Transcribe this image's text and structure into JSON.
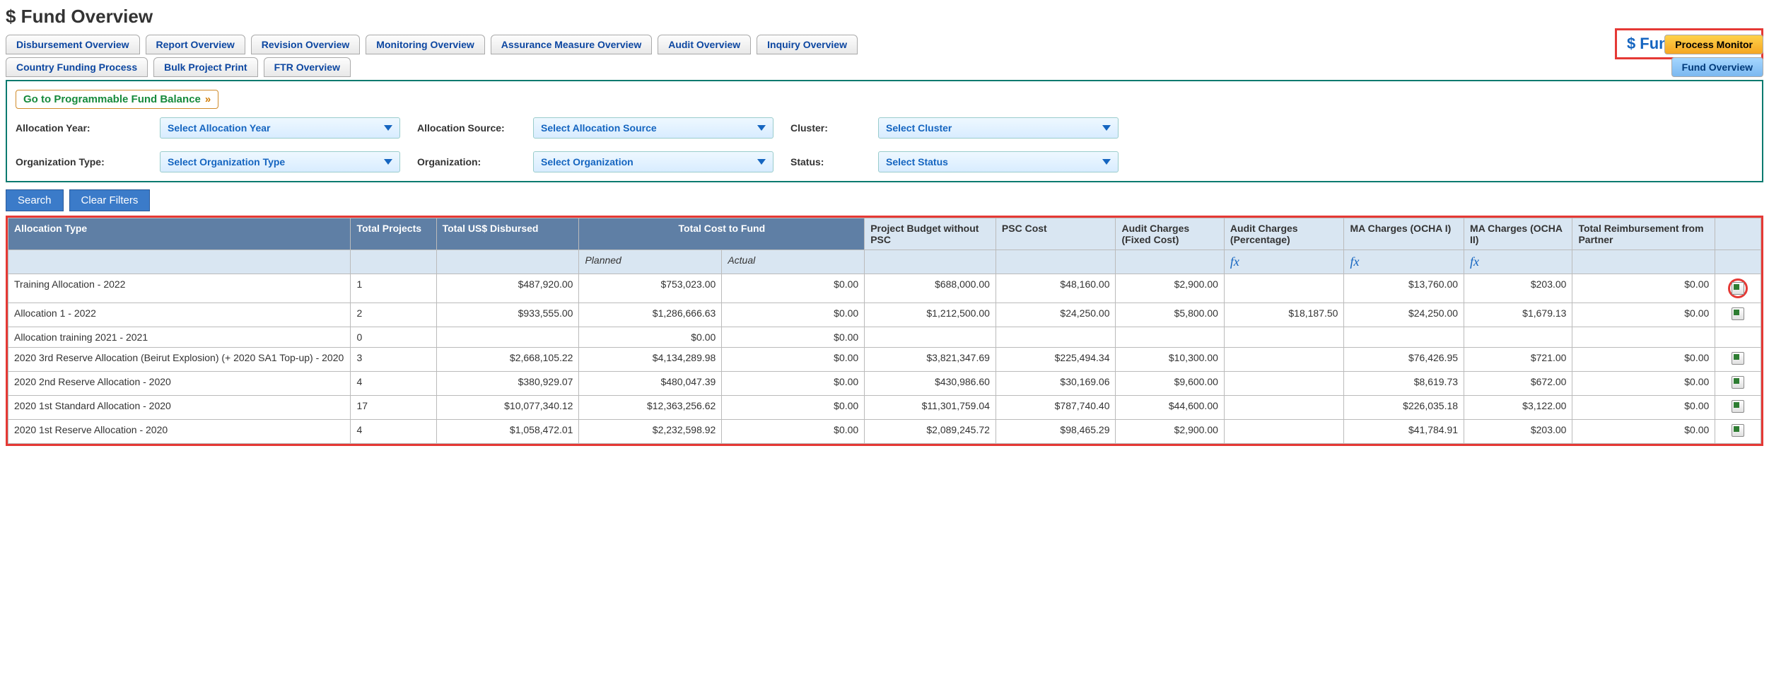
{
  "page_title": "$ Fund Overview",
  "side_title": "$ Fund Overview",
  "tabs_row1": [
    "Disbursement Overview",
    "Report Overview",
    "Revision Overview",
    "Monitoring Overview",
    "Assurance Measure Overview",
    "Audit Overview",
    "Inquiry Overview"
  ],
  "tabs_row2": [
    "Country Funding Process",
    "Bulk Project Print",
    "FTR Overview"
  ],
  "pills": {
    "process_monitor": "Process Monitor",
    "fund_overview": "Fund Overview"
  },
  "go_link": "Go to Programmable Fund Balance",
  "filters": {
    "allocation_year": {
      "label": "Allocation Year:",
      "placeholder": "Select Allocation Year"
    },
    "allocation_source": {
      "label": "Allocation Source:",
      "placeholder": "Select Allocation Source"
    },
    "cluster": {
      "label": "Cluster:",
      "placeholder": "Select Cluster"
    },
    "organization_type": {
      "label": "Organization Type:",
      "placeholder": "Select Organization Type"
    },
    "organization": {
      "label": "Organization:",
      "placeholder": "Select Organization"
    },
    "status": {
      "label": "Status:",
      "placeholder": "Select Status"
    }
  },
  "buttons": {
    "search": "Search",
    "clear": "Clear Filters"
  },
  "table": {
    "headers": {
      "allocation_type": "Allocation Type",
      "total_projects": "Total Projects",
      "total_disbursed": "Total US$ Disbursed",
      "total_cost": "Total Cost to Fund",
      "project_budget": "Project Budget without PSC",
      "psc_cost": "PSC Cost",
      "audit_fixed": "Audit Charges (Fixed Cost)",
      "audit_pct": "Audit Charges (Percentage)",
      "ma1": "MA Charges (OCHA I)",
      "ma2": "MA Charges (OCHA II)",
      "reimbursement": "Total Reimbursement from Partner",
      "planned": "Planned",
      "actual": "Actual",
      "fx": "fx"
    },
    "rows": [
      {
        "type": "Training Allocation - 2022",
        "proj": "1",
        "disb": "$487,920.00",
        "plan": "$753,023.00",
        "act": "$0.00",
        "pbud": "$688,000.00",
        "psc": "$48,160.00",
        "afix": "$2,900.00",
        "apct": "",
        "ma1": "$13,760.00",
        "ma2": "$203.00",
        "reim": "$0.00",
        "icon": true,
        "circle": true
      },
      {
        "type": "Allocation 1 - 2022",
        "proj": "2",
        "disb": "$933,555.00",
        "plan": "$1,286,666.63",
        "act": "$0.00",
        "pbud": "$1,212,500.00",
        "psc": "$24,250.00",
        "afix": "$5,800.00",
        "apct": "$18,187.50",
        "ma1": "$24,250.00",
        "ma2": "$1,679.13",
        "reim": "$0.00",
        "icon": true
      },
      {
        "type": "Allocation training 2021 - 2021",
        "proj": "0",
        "disb": "",
        "plan": "$0.00",
        "act": "$0.00",
        "pbud": "",
        "psc": "",
        "afix": "",
        "apct": "",
        "ma1": "",
        "ma2": "",
        "reim": "",
        "icon": false
      },
      {
        "type": "2020 3rd Reserve Allocation (Beirut Explosion) (+ 2020 SA1 Top-up) - 2020",
        "proj": "3",
        "disb": "$2,668,105.22",
        "plan": "$4,134,289.98",
        "act": "$0.00",
        "pbud": "$3,821,347.69",
        "psc": "$225,494.34",
        "afix": "$10,300.00",
        "apct": "",
        "ma1": "$76,426.95",
        "ma2": "$721.00",
        "reim": "$0.00",
        "icon": true
      },
      {
        "type": "2020 2nd Reserve Allocation - 2020",
        "proj": "4",
        "disb": "$380,929.07",
        "plan": "$480,047.39",
        "act": "$0.00",
        "pbud": "$430,986.60",
        "psc": "$30,169.06",
        "afix": "$9,600.00",
        "apct": "",
        "ma1": "$8,619.73",
        "ma2": "$672.00",
        "reim": "$0.00",
        "icon": true
      },
      {
        "type": "2020 1st Standard Allocation - 2020",
        "proj": "17",
        "disb": "$10,077,340.12",
        "plan": "$12,363,256.62",
        "act": "$0.00",
        "pbud": "$11,301,759.04",
        "psc": "$787,740.40",
        "afix": "$44,600.00",
        "apct": "",
        "ma1": "$226,035.18",
        "ma2": "$3,122.00",
        "reim": "$0.00",
        "icon": true
      },
      {
        "type": "2020 1st Reserve Allocation - 2020",
        "proj": "4",
        "disb": "$1,058,472.01",
        "plan": "$2,232,598.92",
        "act": "$0.00",
        "pbud": "$2,089,245.72",
        "psc": "$98,465.29",
        "afix": "$2,900.00",
        "apct": "",
        "ma1": "$41,784.91",
        "ma2": "$203.00",
        "reim": "$0.00",
        "icon": true
      }
    ]
  }
}
